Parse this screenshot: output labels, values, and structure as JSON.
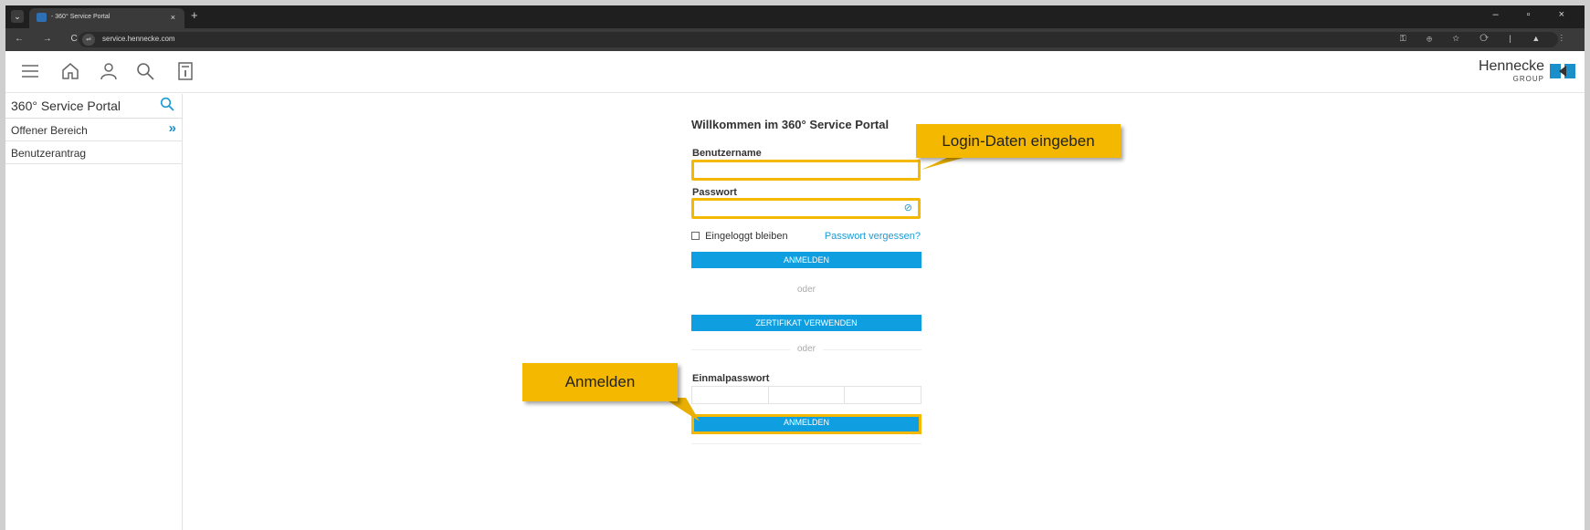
{
  "browser": {
    "tab_title": "- 360° Service Portal",
    "tab_close": "×",
    "new_tab": "+",
    "window_controls": "–  ▫  ×",
    "url": "service.hennecke.com",
    "nav_buttons": "← → C",
    "addr_right_icons": "⚿ ⊕ ☆ ⟳ | ▲ ⋮"
  },
  "header": {
    "icons": [
      "menu-icon",
      "home-icon",
      "user-icon",
      "search-icon",
      "info-card-icon"
    ],
    "logo_text": "Hennecke",
    "logo_sub": "GROUP"
  },
  "sidebar": {
    "title": "360° Service Portal",
    "items": [
      {
        "label": "Offener Bereich",
        "expand": "»"
      },
      {
        "label": "Benutzerantrag"
      }
    ]
  },
  "login": {
    "title": "Willkommen im 360° Service Portal",
    "username_label": "Benutzername",
    "password_label": "Passwort",
    "remember_label": "Eingeloggt bleiben",
    "forgot_link": "Passwort vergessen?",
    "login_button": "ANMELDEN",
    "or_1": "oder",
    "certificate_button": "ZERTIFIKAT VERWENDEN",
    "or_2": "oder",
    "otp_label": "Einmalpasswort",
    "otp_login_button": "ANMELDEN"
  },
  "callouts": {
    "login_data": "Login-Daten eingeben",
    "login": "Anmelden"
  },
  "colors": {
    "accent": "#0f9fe0",
    "highlight": "#f5b800",
    "link": "#1a9bd6"
  }
}
